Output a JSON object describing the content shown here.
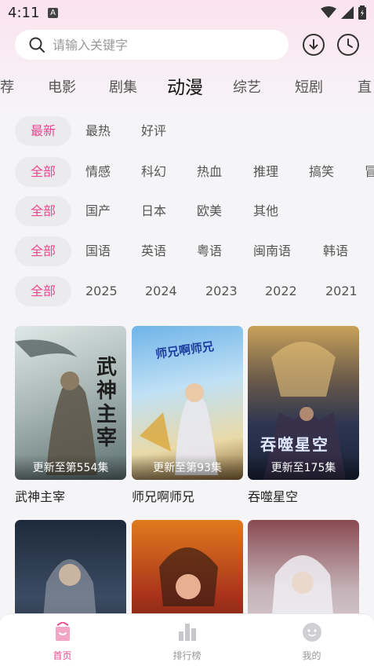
{
  "status_bar": {
    "time": "4:11",
    "notification_icon": "A"
  },
  "search": {
    "placeholder": "请输入关键字"
  },
  "header_icons": [
    "download-icon",
    "history-icon"
  ],
  "categories": [
    {
      "label": "荐"
    },
    {
      "label": "电影"
    },
    {
      "label": "剧集"
    },
    {
      "label": "动漫",
      "active": true
    },
    {
      "label": "综艺"
    },
    {
      "label": "短剧"
    },
    {
      "label": "直"
    }
  ],
  "filters": {
    "sort": [
      "最新",
      "最热",
      "好评"
    ],
    "genre": [
      "全部",
      "情感",
      "科幻",
      "热血",
      "推理",
      "搞笑",
      "冒"
    ],
    "region": [
      "全部",
      "国产",
      "日本",
      "欧美",
      "其他"
    ],
    "language": [
      "全部",
      "国语",
      "英语",
      "粤语",
      "闽南语",
      "韩语"
    ],
    "year": [
      "全部",
      "2025",
      "2024",
      "2023",
      "2022",
      "2021"
    ]
  },
  "shows": [
    {
      "title": "武神主宰",
      "badge": "更新至第554集",
      "poster_text": "武神主宰"
    },
    {
      "title": "师兄啊师兄",
      "badge": "更新至第93集",
      "poster_text": "师兄啊师兄"
    },
    {
      "title": "吞噬星空",
      "badge": "更新至175集",
      "poster_text": "吞噬星空"
    },
    {
      "title": "",
      "badge": ""
    },
    {
      "title": "",
      "badge": ""
    },
    {
      "title": "",
      "badge": ""
    }
  ],
  "tabbar": [
    {
      "label": "首页",
      "active": true,
      "icon": "home-icon"
    },
    {
      "label": "排行榜",
      "active": false,
      "icon": "ranking-icon"
    },
    {
      "label": "我的",
      "active": false,
      "icon": "profile-icon"
    }
  ],
  "colors": {
    "accent": "#e9488e",
    "chip_bg": "#ebebee",
    "background": "#f5f5f7"
  }
}
